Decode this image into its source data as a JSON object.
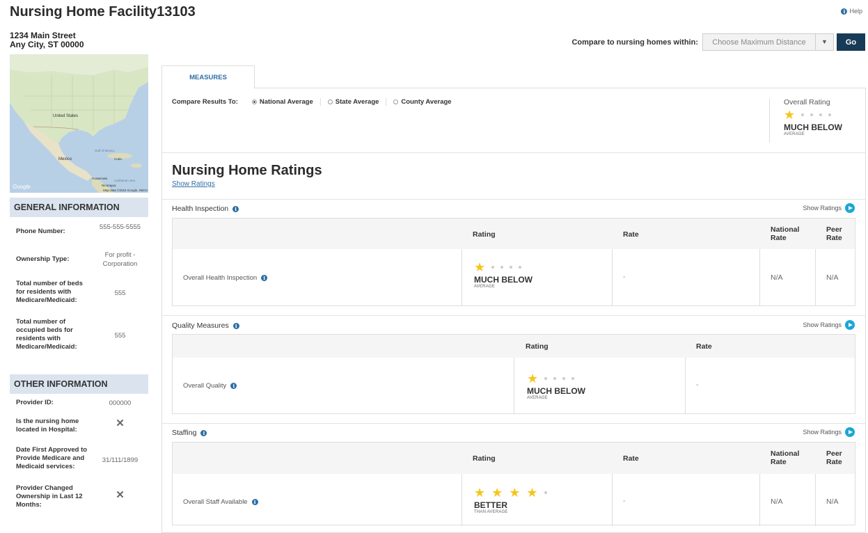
{
  "page": {
    "title": "Nursing Home Facility13103",
    "help": "Help"
  },
  "address": {
    "line1": "1234 Main Street",
    "line2": "Any City, ST 00000"
  },
  "compare": {
    "label": "Compare to nursing homes within:",
    "select_placeholder": "Choose Maximum Distance",
    "go_label": "Go"
  },
  "map": {
    "attribution": "Map data ©2015 Google, INEGI",
    "google": "Google",
    "labels": {
      "us": "United States",
      "mexico": "Mexico",
      "gulf": "Gulf of Mexico",
      "cuba": "Cuba",
      "guatemala": "Guatemala",
      "caribbean": "Caribbean Sea",
      "nicaragua": "Nicaragua"
    }
  },
  "general": {
    "heading": "GENERAL INFORMATION",
    "rows": [
      {
        "k": "Phone Number:",
        "v": "555-555-5555"
      },
      {
        "k": "Ownership Type:",
        "v": "For profit - Corporation"
      },
      {
        "k": "Total number of beds for residents with Medicare/Medicaid:",
        "v": "555"
      },
      {
        "k": "Total number of occupied beds for residents with Medicare/Medicaid:",
        "v": "555"
      }
    ]
  },
  "other": {
    "heading": "OTHER INFORMATION",
    "rows": [
      {
        "k": "Provider ID:",
        "v": "000000"
      },
      {
        "k": "Is the nursing home located in Hospital:",
        "v": "✕"
      },
      {
        "k": "Date First Approved to Provide Medicare and Medicaid services:",
        "v": "31/111/1899"
      },
      {
        "k": "Provider Changed Ownership in Last 12 Months:",
        "v": "✕"
      }
    ]
  },
  "tabs": {
    "measures": "MEASURES"
  },
  "compare_results": {
    "label": "Compare Results To:",
    "options": [
      "National Average",
      "State Average",
      "County Average"
    ],
    "selected": "National Average"
  },
  "overall": {
    "heading": "Overall Rating",
    "stars": 1,
    "label": "MUCH BELOW",
    "sub": "AVERAGE"
  },
  "ratings": {
    "title": "Nursing Home Ratings",
    "show": "Show Ratings"
  },
  "sections": {
    "health": {
      "title": "Health Inspection",
      "show": "Show Ratings",
      "cols": {
        "rating": "Rating",
        "rate": "Rate",
        "national": "National Rate",
        "peer": "Peer Rate"
      },
      "row": {
        "name": "Overall Health Inspection",
        "stars": 1,
        "label": "MUCH BELOW",
        "sub": "AVERAGE",
        "rate": "-",
        "national": "N/A",
        "peer": "N/A"
      }
    },
    "quality": {
      "title": "Quality Measures",
      "show": "Show Ratings",
      "cols": {
        "rating": "Rating",
        "rate": "Rate"
      },
      "row": {
        "name": "Overall Quality",
        "stars": 1,
        "label": "MUCH BELOW",
        "sub": "AVERAGE",
        "rate": "-"
      }
    },
    "staffing": {
      "title": "Staffing",
      "show": "Show Ratings",
      "cols": {
        "rating": "Rating",
        "rate": "Rate",
        "national": "National Rate",
        "peer": "Peer Rate"
      },
      "row": {
        "name": "Overall Staff Available",
        "stars": 4,
        "label": "BETTER",
        "sub": "THAN AVERAGE",
        "rate": "-",
        "national": "N/A",
        "peer": "N/A"
      }
    }
  },
  "colors": {
    "accent": "#2e6da4",
    "go": "#173a57",
    "star": "#f5c518",
    "play": "#1aa7d6",
    "section_bg": "#dbe4ee"
  }
}
